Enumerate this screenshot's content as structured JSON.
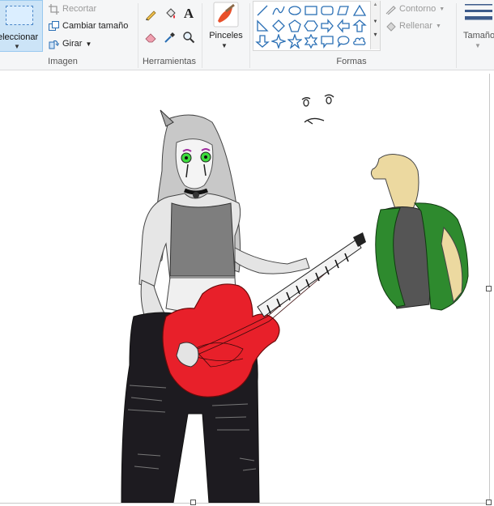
{
  "ribbon": {
    "image_group": {
      "select_label": "eleccionar",
      "crop_label": "Recortar",
      "resize_label": "Cambiar tamaño",
      "rotate_label": "Girar",
      "group_label": "Imagen"
    },
    "tools_group": {
      "group_label": "Herramientas",
      "tools": [
        "pencil-icon",
        "fill-bucket-icon",
        "text-icon",
        "eraser-icon",
        "color-picker-icon",
        "magnifier-icon"
      ]
    },
    "brushes": {
      "label": "Pinceles"
    },
    "shapes_group": {
      "group_label": "Formas",
      "outline_label": "Contorno",
      "fill_label": "Rellenar"
    },
    "size": {
      "label": "Tamaño"
    }
  },
  "colors": {
    "select_bg": "#cce4f7",
    "guitar_red": "#e8202a",
    "jacket_green": "#2e8a2e"
  }
}
